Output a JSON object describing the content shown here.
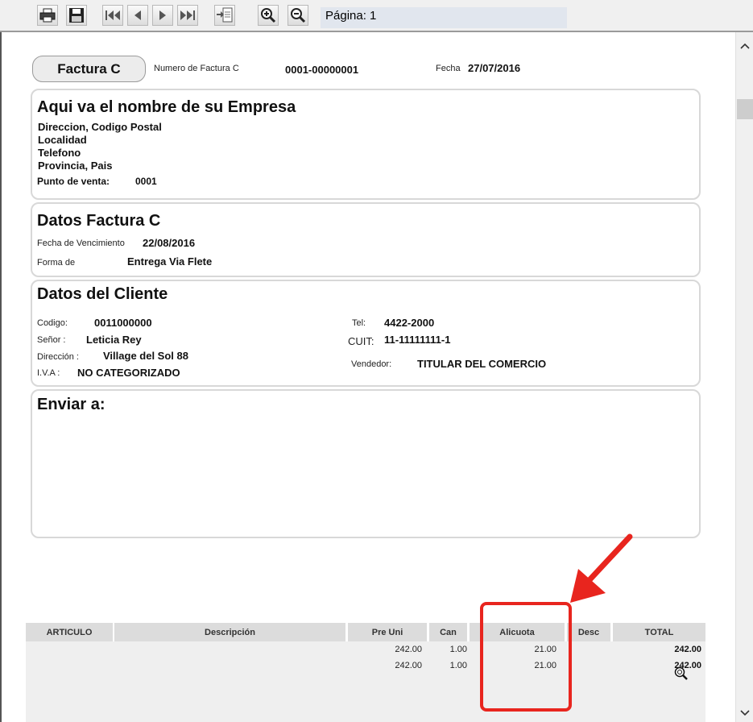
{
  "toolbar": {
    "page_label": "Página: 1"
  },
  "invoice": {
    "badge": "Factura C",
    "number_label": "Numero de Factura C",
    "number_value": "0001-00000001",
    "date_label": "Fecha",
    "date_value": "27/07/2016"
  },
  "empresa": {
    "title": "Aqui va el nombre de su Empresa",
    "line1": "Direccion, Codigo Postal",
    "line2": "Localidad",
    "line3": "Telefono",
    "line4": "Provincia, Pais",
    "pv_label": "Punto de venta:",
    "pv_value": "0001"
  },
  "datos_factura": {
    "title": "Datos Factura C",
    "venc_label": "Fecha de Vencimiento",
    "venc_value": "22/08/2016",
    "forma_label": "Forma de",
    "forma_value": "Entrega Via Flete"
  },
  "cliente": {
    "title": "Datos del Cliente",
    "codigo_label": "Codigo:",
    "codigo_value": "0011000000",
    "senor_label": "Señor :",
    "senor_value": "Leticia Rey",
    "direccion_label": "Dirección :",
    "direccion_value": "Village del Sol 88",
    "iva_label": "I.V.A :",
    "iva_value": "NO CATEGORIZADO",
    "tel_label": "Tel:",
    "tel_value": "4422-2000",
    "cuit_label": "CUIT:",
    "cuit_value": "11-11111111-1",
    "vendedor_label": "Vendedor:",
    "vendedor_value": "TITULAR DEL COMERCIO"
  },
  "enviar": {
    "title": "Enviar a:"
  },
  "table": {
    "headers": [
      "ARTICULO",
      "Descripción",
      "Pre Uni",
      "Can",
      "Alicuota",
      "Desc",
      "TOTAL"
    ],
    "rows": [
      {
        "pre_uni": "242.00",
        "can": "1.00",
        "alicuota": "21.00",
        "total": "242.00"
      },
      {
        "pre_uni": "242.00",
        "can": "1.00",
        "alicuota": "21.00",
        "total": "242.00"
      }
    ]
  },
  "colors": {
    "annotation": "#e8251e",
    "header_bg": "#dcdcdc",
    "box_border": "#d8d8d8"
  },
  "icons": [
    "print-icon",
    "save-icon",
    "first-page-icon",
    "prev-page-icon",
    "next-page-icon",
    "last-page-icon",
    "export-icon",
    "zoom-in-icon",
    "zoom-out-icon",
    "scroll-up-icon",
    "scroll-down-icon",
    "magnifier-cursor-icon",
    "annotation-arrow-icon"
  ]
}
